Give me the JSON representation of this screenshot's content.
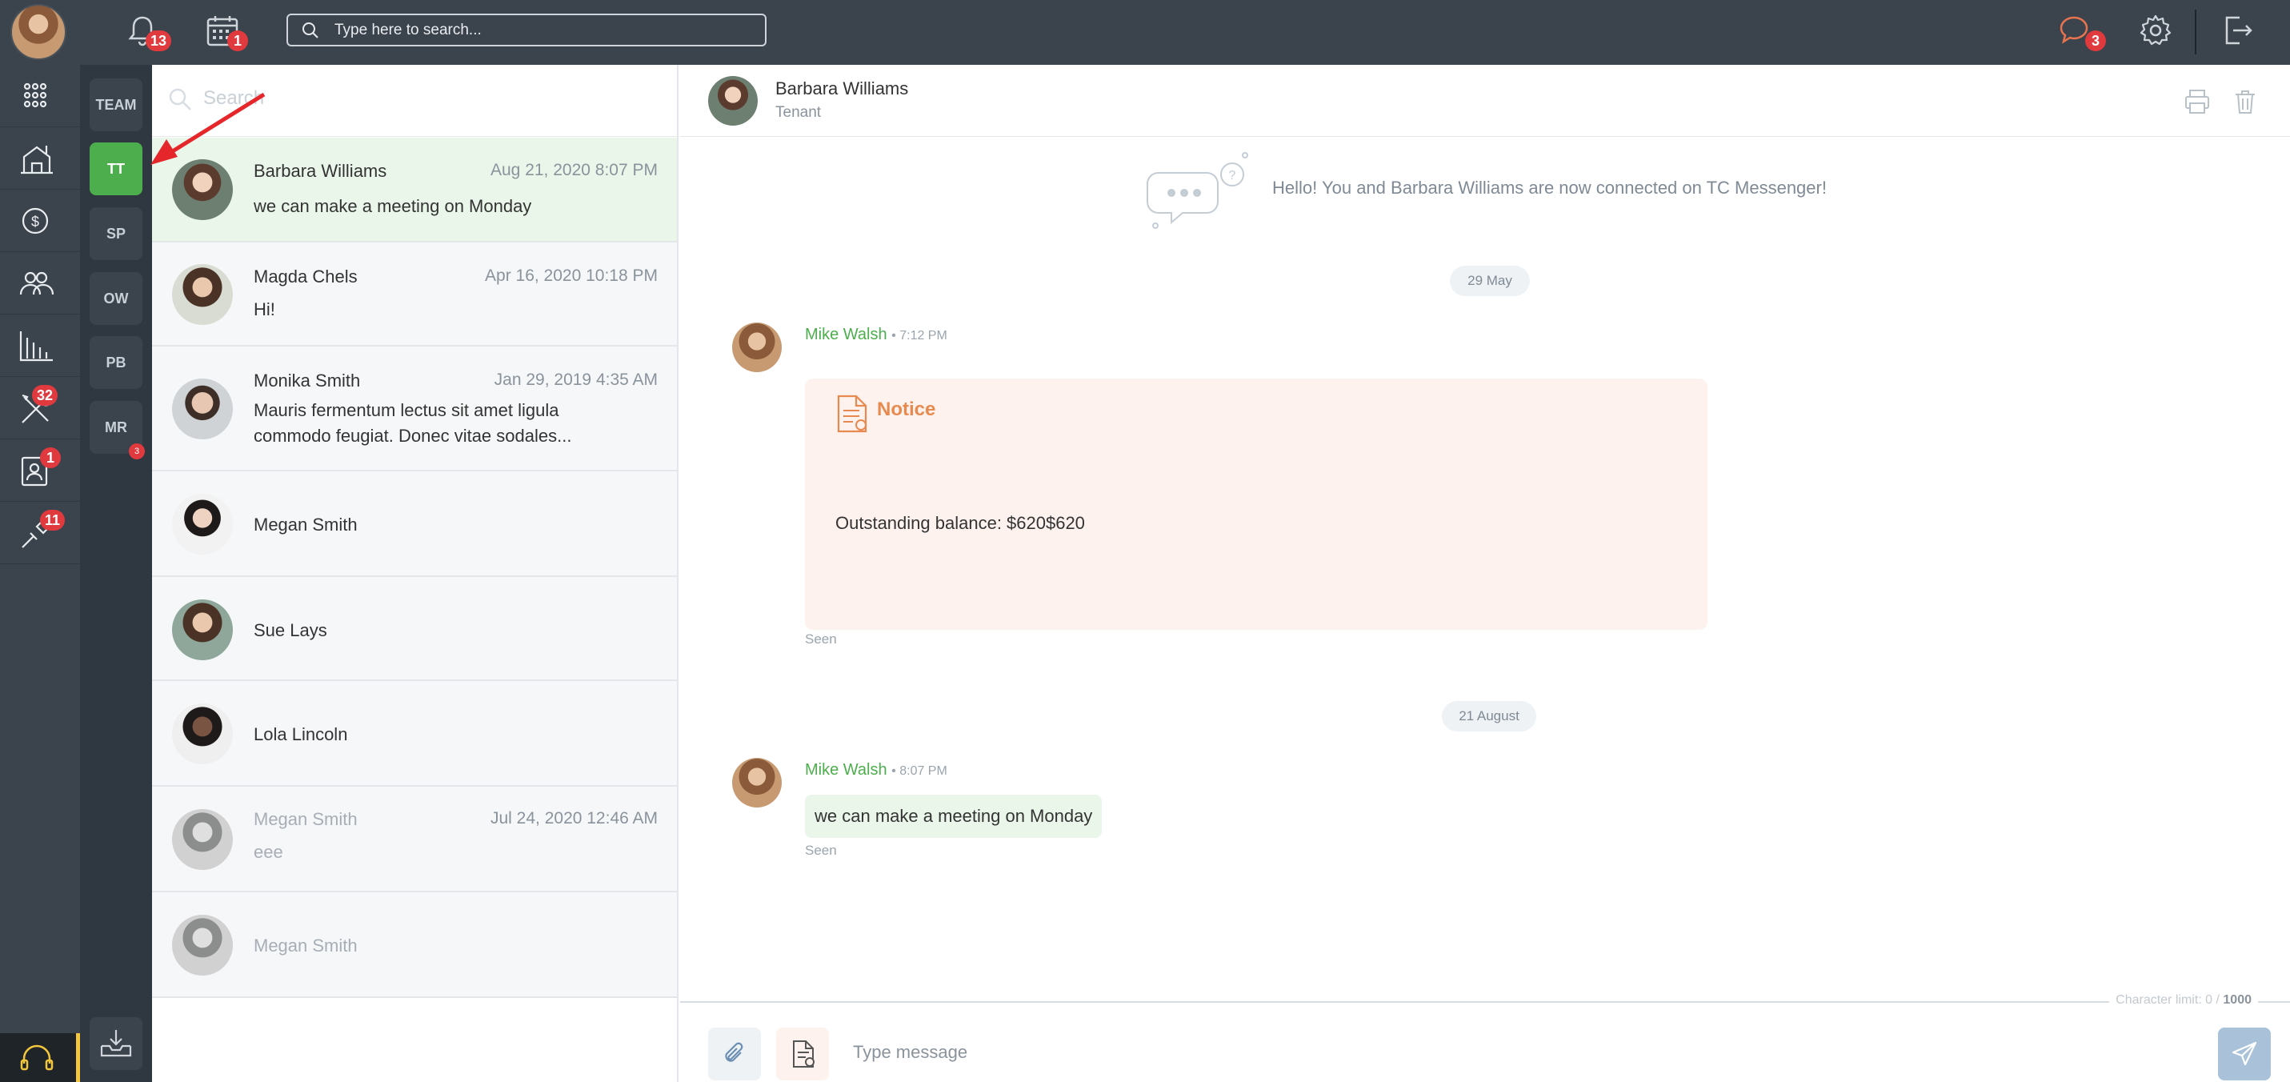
{
  "topbar": {
    "notifications_badge": "13",
    "calendar_badge": "1",
    "search_placeholder": "Type here to search...",
    "messages_badge": "3"
  },
  "leftnav": {
    "items": [
      {
        "icon": "apps-grid-icon",
        "badge": ""
      },
      {
        "icon": "properties-icon",
        "badge": ""
      },
      {
        "icon": "accounting-icon",
        "badge": ""
      },
      {
        "icon": "contacts-icon",
        "badge": ""
      },
      {
        "icon": "reports-icon",
        "badge": ""
      },
      {
        "icon": "maintenance-icon",
        "badge": "32"
      },
      {
        "icon": "tenant-screening-icon",
        "badge": "1"
      },
      {
        "icon": "tools-icon",
        "badge": "11"
      }
    ]
  },
  "groups": {
    "items": [
      {
        "label": "TEAM",
        "active": false,
        "badge": ""
      },
      {
        "label": "TT",
        "active": true,
        "badge": ""
      },
      {
        "label": "SP",
        "active": false,
        "badge": ""
      },
      {
        "label": "OW",
        "active": false,
        "badge": ""
      },
      {
        "label": "PB",
        "active": false,
        "badge": ""
      },
      {
        "label": "MR",
        "active": false,
        "badge": "3"
      }
    ]
  },
  "convlist": {
    "search_placeholder": "Search",
    "conversations": [
      {
        "name": "Barbara Williams",
        "date": "Aug 21, 2020 8:07 PM",
        "message": "we can make a meeting on Monday"
      },
      {
        "name": "Magda Chels",
        "date": "Apr 16, 2020 10:18 PM",
        "message": "Hi!"
      },
      {
        "name": "Monika Smith",
        "date": "Jan 29, 2019 4:35 AM",
        "message": "Mauris fermentum lectus sit amet ligula commodo feugiat. Donec vitae sodales..."
      },
      {
        "name": "Megan Smith",
        "date": "",
        "message": ""
      },
      {
        "name": "Sue Lays",
        "date": "",
        "message": ""
      },
      {
        "name": "Lola Lincoln",
        "date": "",
        "message": ""
      },
      {
        "name": "Megan Smith",
        "date": "Jul 24, 2020 12:46 AM",
        "message": "eee"
      },
      {
        "name": "Megan Smith",
        "date": "",
        "message": ""
      }
    ]
  },
  "chat": {
    "contact_name": "Barbara Williams",
    "contact_role": "Tenant",
    "welcome": "Hello! You and Barbara Williams are now connected on TC Messenger!",
    "date_1": "29 May",
    "msg1_sender": "Mike Walsh",
    "msg1_time": "• 7:12 PM",
    "notice_title": "Notice",
    "notice_body": "Outstanding balance: $620$620",
    "seen_1": "Seen",
    "date_2": "21 August",
    "msg2_sender": "Mike Walsh",
    "msg2_time": "• 8:07 PM",
    "msg2_text": "we can make a meeting on Monday",
    "seen_2": "Seen",
    "char_limit_label": "Character limit: 0 / ",
    "char_limit_max": "1000",
    "composer_placeholder": "Type message"
  },
  "colors": {
    "topbar_bg": "#3b444d",
    "accent_green": "#4cae4c",
    "badge_red": "#e03a3e",
    "notice_orange": "#e88a4f"
  }
}
